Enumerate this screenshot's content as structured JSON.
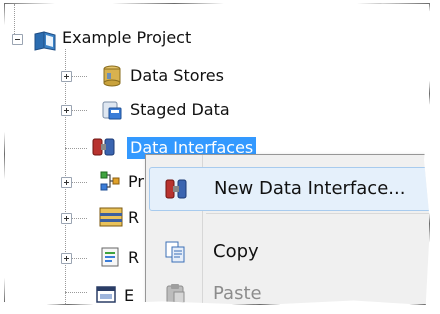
{
  "tree": {
    "root": {
      "label": "Example Project",
      "icon": "book-icon",
      "expanded": true
    },
    "children": [
      {
        "label": "Data Stores",
        "icon": "database-icon",
        "expanded": false,
        "selected": false
      },
      {
        "label": "Staged Data",
        "icon": "staged-data-icon",
        "expanded": false,
        "selected": false
      },
      {
        "label": "Data Interfaces",
        "icon": "data-interface-icon",
        "expanded": null,
        "selected": true
      },
      {
        "label": "Pr",
        "icon": "process-icon",
        "expanded": false,
        "selected": false
      },
      {
        "label": "R",
        "icon": "results-icon",
        "expanded": false,
        "selected": false
      },
      {
        "label": "R",
        "icon": "report-icon",
        "expanded": false,
        "selected": false
      },
      {
        "label": "E",
        "icon": "window-icon",
        "expanded": null,
        "selected": false
      }
    ]
  },
  "context_menu": {
    "items": [
      {
        "label": "New Data Interface...",
        "icon": "data-interface-icon",
        "highlighted": true,
        "enabled": true
      },
      {
        "label": "Copy",
        "icon": "copy-icon",
        "highlighted": false,
        "enabled": true
      },
      {
        "label": "Paste",
        "icon": "paste-icon",
        "highlighted": false,
        "enabled": false
      }
    ]
  },
  "colors": {
    "selection": "#3399ff",
    "menu_background": "#f0f0f0",
    "menu_highlight": "#e5f0fb"
  }
}
